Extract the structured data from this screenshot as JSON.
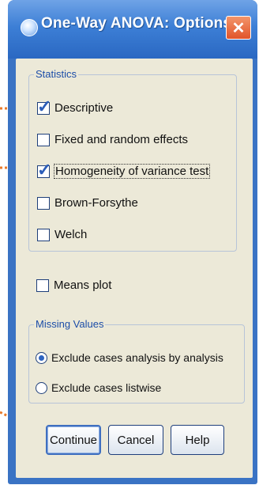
{
  "window": {
    "title": "One-Way ANOVA: Options",
    "close_glyph": "✕"
  },
  "statistics": {
    "group_label": "Statistics",
    "items": [
      {
        "label": "Descriptive",
        "checked": true
      },
      {
        "label": "Fixed and random effects",
        "checked": false
      },
      {
        "label": "Homogeneity of variance test",
        "checked": true
      },
      {
        "label": "Brown-Forsythe",
        "checked": false
      },
      {
        "label": "Welch",
        "checked": false
      }
    ]
  },
  "means_plot": {
    "label": "Means plot",
    "checked": false
  },
  "missing_values": {
    "group_label": "Missing Values",
    "options": [
      {
        "label": "Exclude cases analysis by analysis",
        "selected": true
      },
      {
        "label": "Exclude cases listwise",
        "selected": false
      }
    ]
  },
  "buttons": {
    "continue": "Continue",
    "cancel": "Cancel",
    "help": "Help"
  },
  "colors": {
    "accent": "#3a73c4",
    "callout": "#e87a2a"
  }
}
